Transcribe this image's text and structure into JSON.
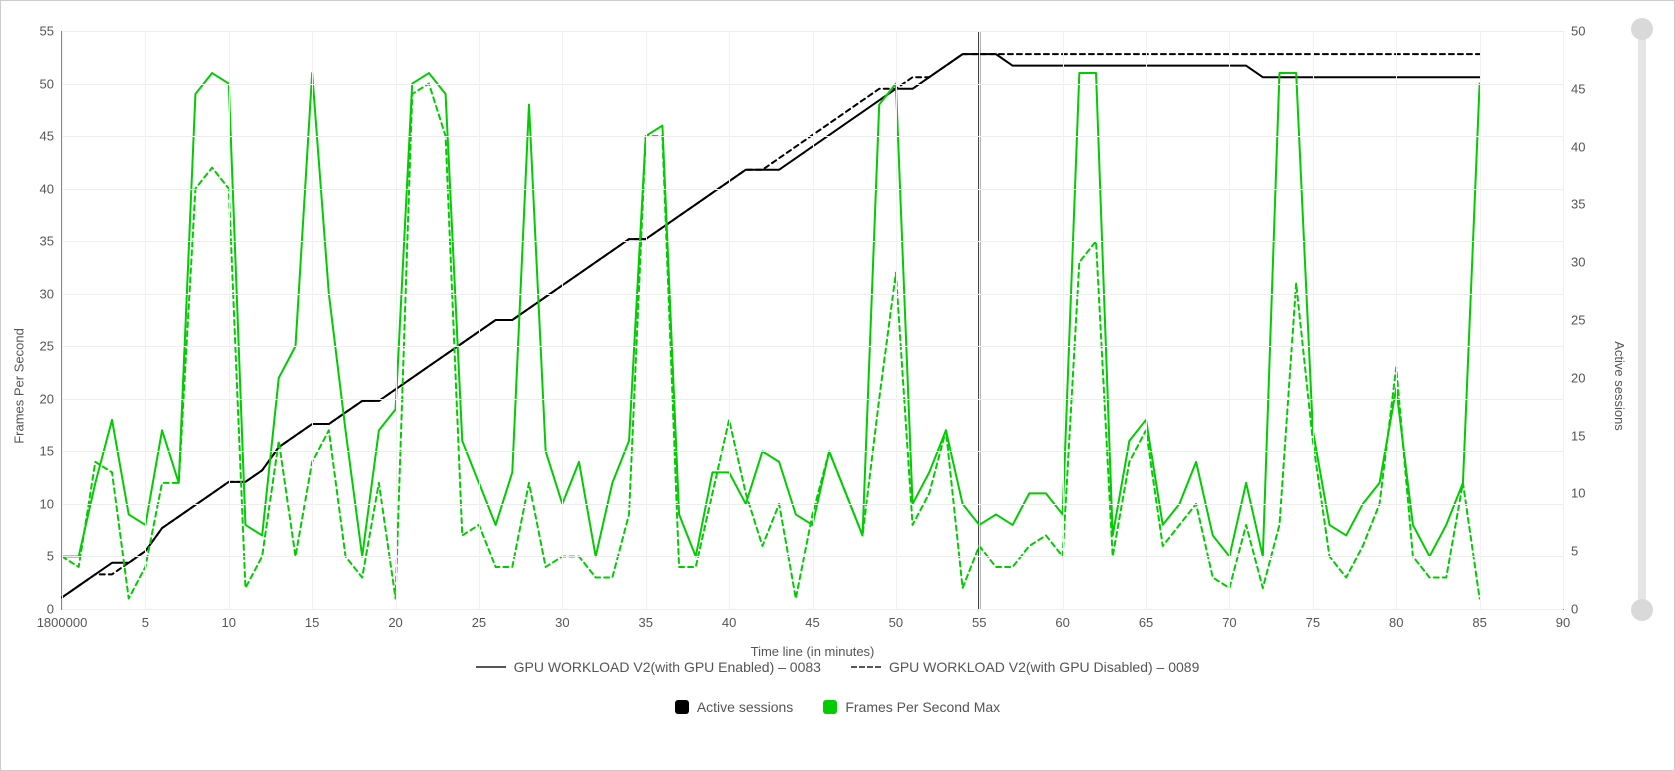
{
  "chart_data": {
    "type": "line",
    "title": "",
    "xlabel": "Time line (in minutes)",
    "ylabel_left": "Frames Per Second",
    "ylabel_right": "Active sessions",
    "xlim": [
      0,
      90
    ],
    "ylim_left": [
      0,
      55
    ],
    "ylim_right": [
      0,
      50
    ],
    "x_ticks": [
      "1800000",
      "5",
      "10",
      "15",
      "20",
      "25",
      "30",
      "35",
      "40",
      "45",
      "50",
      "55",
      "60",
      "65",
      "70",
      "75",
      "80",
      "85",
      "90"
    ],
    "y_ticks_left": [
      0,
      5,
      10,
      15,
      20,
      25,
      30,
      35,
      40,
      45,
      50,
      55
    ],
    "y_ticks_right": [
      0,
      5,
      10,
      15,
      20,
      25,
      30,
      35,
      40,
      45,
      50
    ],
    "categories_x": [
      0,
      1,
      2,
      3,
      4,
      5,
      6,
      7,
      8,
      9,
      10,
      11,
      12,
      13,
      14,
      15,
      16,
      17,
      18,
      19,
      20,
      21,
      22,
      23,
      24,
      25,
      26,
      27,
      28,
      29,
      30,
      31,
      32,
      33,
      34,
      35,
      36,
      37,
      38,
      39,
      40,
      41,
      42,
      43,
      44,
      45,
      46,
      47,
      48,
      49,
      50,
      51,
      52,
      53,
      54,
      55,
      56,
      57,
      58,
      59,
      60,
      61,
      62,
      63,
      64,
      65,
      66,
      67,
      68,
      69,
      70,
      71,
      72,
      73,
      74,
      75,
      76,
      77,
      78,
      79,
      80,
      81,
      82,
      83,
      84,
      85
    ],
    "series": [
      {
        "name": "Active sessions – GPU WORKLOAD V2(with GPU Enabled) – 0083",
        "axis": "right",
        "color": "#000",
        "style": "solid",
        "values": [
          1,
          2,
          3,
          4,
          4,
          5,
          7,
          8,
          9,
          10,
          11,
          11,
          12,
          14,
          15,
          16,
          16,
          17,
          18,
          18,
          19,
          20,
          21,
          22,
          23,
          24,
          25,
          25,
          26,
          27,
          28,
          29,
          30,
          31,
          32,
          32,
          33,
          34,
          35,
          36,
          37,
          38,
          38,
          38,
          39,
          40,
          41,
          42,
          43,
          44,
          45,
          45,
          46,
          47,
          48,
          48,
          48,
          47,
          47,
          47,
          47,
          47,
          47,
          47,
          47,
          47,
          47,
          47,
          47,
          47,
          47,
          47,
          46,
          46,
          46,
          46,
          46,
          46,
          46,
          46,
          46,
          46,
          46,
          46,
          46,
          46
        ]
      },
      {
        "name": "Active sessions – GPU WORKLOAD V2(with GPU Disabled) – 0089",
        "axis": "right",
        "color": "#000",
        "style": "dashed",
        "values": [
          1,
          2,
          3,
          3,
          4,
          5,
          7,
          8,
          9,
          10,
          11,
          11,
          12,
          14,
          15,
          16,
          16,
          17,
          18,
          18,
          19,
          20,
          21,
          22,
          23,
          24,
          25,
          25,
          26,
          27,
          28,
          29,
          30,
          31,
          32,
          32,
          33,
          34,
          35,
          36,
          37,
          38,
          38,
          39,
          40,
          41,
          42,
          43,
          44,
          45,
          45,
          46,
          46,
          47,
          48,
          48,
          48,
          48,
          48,
          48,
          48,
          48,
          48,
          48,
          48,
          48,
          48,
          48,
          48,
          48,
          48,
          48,
          48,
          48,
          48,
          48,
          48,
          48,
          48,
          48,
          48,
          48,
          48,
          48,
          48,
          48
        ]
      },
      {
        "name": "Frames Per Second Max – GPU WORKLOAD V2(with GPU Enabled) – 0083",
        "axis": "left",
        "color": "#00cc00",
        "style": "solid",
        "values": [
          5,
          5,
          12,
          18,
          9,
          8,
          17,
          12,
          49,
          51,
          50,
          8,
          7,
          22,
          25,
          51,
          30,
          17,
          5,
          17,
          19,
          50,
          51,
          49,
          16,
          12,
          8,
          13,
          48,
          15,
          10,
          14,
          5,
          12,
          16,
          45,
          46,
          9,
          5,
          13,
          13,
          10,
          15,
          14,
          9,
          8,
          15,
          11,
          7,
          48,
          50,
          10,
          13,
          17,
          10,
          8,
          9,
          8,
          11,
          11,
          9,
          51,
          51,
          7,
          16,
          18,
          8,
          10,
          14,
          7,
          5,
          12,
          5,
          51,
          51,
          17,
          8,
          7,
          10,
          12,
          21,
          8,
          5,
          8,
          12,
          50
        ]
      },
      {
        "name": "Frames Per Second Max – GPU WORKLOAD V2(with GPU Disabled) – 0089",
        "axis": "left",
        "color": "#00cc00",
        "style": "dashed",
        "values": [
          5,
          4,
          14,
          13,
          1,
          4,
          12,
          12,
          40,
          42,
          40,
          2,
          5,
          16,
          5,
          14,
          17,
          5,
          3,
          12,
          1,
          49,
          50,
          45,
          7,
          8,
          4,
          4,
          12,
          4,
          5,
          5,
          3,
          3,
          9,
          45,
          45,
          4,
          4,
          11,
          18,
          11,
          6,
          10,
          1,
          9,
          15,
          11,
          7,
          20,
          32,
          8,
          11,
          17,
          2,
          6,
          4,
          4,
          6,
          7,
          5,
          33,
          35,
          5,
          14,
          17,
          6,
          8,
          10,
          3,
          2,
          8,
          2,
          8,
          31,
          16,
          5,
          3,
          6,
          10,
          23,
          5,
          3,
          3,
          12,
          1
        ]
      }
    ],
    "vertical_marker_x": 55,
    "legend_style": [
      {
        "label": "GPU WORKLOAD V2(with GPU Enabled) – 0083",
        "line": "solid"
      },
      {
        "label": "GPU WORKLOAD V2(with GPU Disabled) – 0089",
        "line": "dashed"
      }
    ],
    "legend_color": [
      {
        "label": "Active sessions",
        "color": "#000"
      },
      {
        "label": "Frames Per Second Max",
        "color": "#00cc00"
      }
    ]
  },
  "slider": {
    "top_thumb_pct": 0,
    "bottom_thumb_pct": 100
  }
}
